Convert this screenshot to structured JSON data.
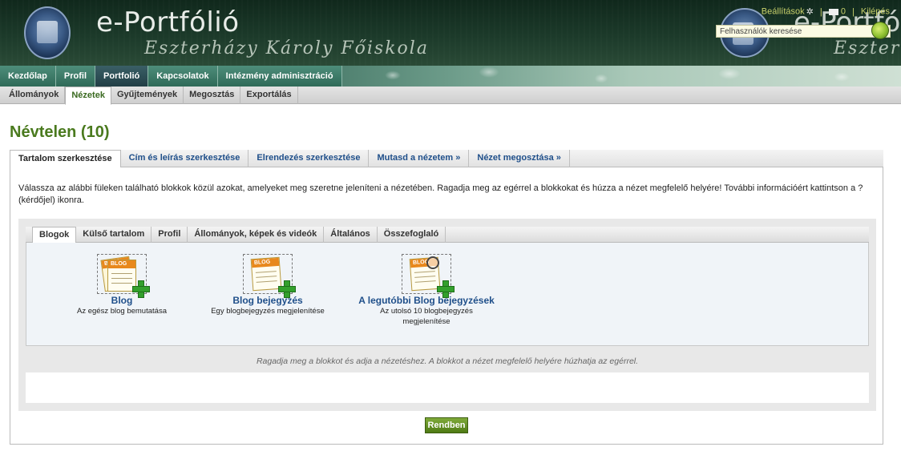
{
  "header": {
    "site_title": "e-Portfólió",
    "site_subtitle": "Eszterházy Károly Főiskola",
    "site_title_echo": "e-Portfó",
    "site_subtitle_echo": "Eszterházy",
    "links": {
      "settings": "Beállítások",
      "messages_count": "0",
      "logout": "Kilépés"
    },
    "search": {
      "placeholder": "Felhasználók keresése"
    }
  },
  "main_nav": [
    {
      "label": "Kezdőlap",
      "active": false
    },
    {
      "label": "Profil",
      "active": false
    },
    {
      "label": "Portfolió",
      "active": true
    },
    {
      "label": "Kapcsolatok",
      "active": false
    },
    {
      "label": "Intézmény adminisztráció",
      "active": false
    }
  ],
  "sub_nav": [
    {
      "label": "Állományok",
      "active": false
    },
    {
      "label": "Nézetek",
      "active": true
    },
    {
      "label": "Gyűjtemények",
      "active": false
    },
    {
      "label": "Megosztás",
      "active": false
    },
    {
      "label": "Exportálás",
      "active": false
    }
  ],
  "page": {
    "title": "Névtelen (10)"
  },
  "view_tabs": [
    {
      "label": "Tartalom szerkesztése",
      "active": true
    },
    {
      "label": "Cím és leírás szerkesztése",
      "active": false
    },
    {
      "label": "Elrendezés szerkesztése",
      "active": false
    },
    {
      "label": "Mutasd a nézetem »",
      "active": false
    },
    {
      "label": "Nézet megosztása »",
      "active": false
    }
  ],
  "instructions": "Válassza az alábbi füleken található blokkok közül azokat, amelyeket meg szeretne jeleníteni a nézetében. Ragadja meg az egérrel a blokkokat és húzza a nézet megfelelő helyére! További információért kattintson a ? (kérdőjel) ikonra.",
  "category_tabs": [
    {
      "label": "Blogok",
      "active": true
    },
    {
      "label": "Külső tartalom",
      "active": false
    },
    {
      "label": "Profil",
      "active": false
    },
    {
      "label": "Állományok, képek és videók",
      "active": false
    },
    {
      "label": "Általános",
      "active": false
    },
    {
      "label": "Összefoglaló",
      "active": false
    }
  ],
  "blocks": [
    {
      "title": "Blog",
      "description": "Az egész blog bemutatása",
      "icon": "blog-stack-icon"
    },
    {
      "title": "Blog bejegyzés",
      "description": "Egy blogbejegyzés megjelenítése",
      "icon": "blog-post-icon"
    },
    {
      "title": "A legutóbbi Blog bejegyzések",
      "description": "Az utolsó 10 blogbejegyzés megjelenítése",
      "icon": "blog-recent-icon"
    }
  ],
  "blog_icon_label": "BLOG",
  "hint": "Ragadja meg a blokkot és adja a nézetéshez. A blokkot a nézet megfelelő helyére húzhatja az egérrel.",
  "actions": {
    "ok_label": "Rendben"
  },
  "colors": {
    "accent_green": "#4a7a1e",
    "link_blue": "#1f4f8a",
    "header_dark": "#1c3a2a",
    "toplink_yellow": "#c8d06a"
  }
}
